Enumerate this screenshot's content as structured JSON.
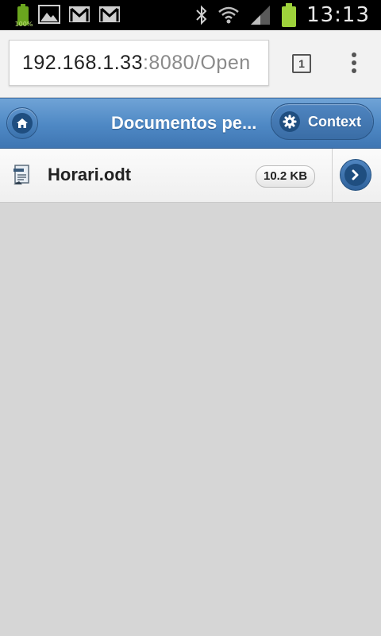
{
  "status_bar": {
    "battery_small_label": "100%",
    "clock": "13:13",
    "icons": [
      "battery-icon",
      "image-icon",
      "gmail-icon",
      "gmail-icon",
      "bluetooth-icon",
      "wifi-icon",
      "signal-icon",
      "battery-icon"
    ]
  },
  "browser": {
    "url_host": "192.168.1.33",
    "url_rest": ":8080/Open",
    "tab_count": "1"
  },
  "header": {
    "title": "Documentos pe...",
    "context_label": "Context",
    "accent_color": "#4e88c4"
  },
  "list": {
    "items": [
      {
        "name": "Horari.odt",
        "size": "10.2 KB",
        "icon": "document-icon"
      }
    ]
  }
}
